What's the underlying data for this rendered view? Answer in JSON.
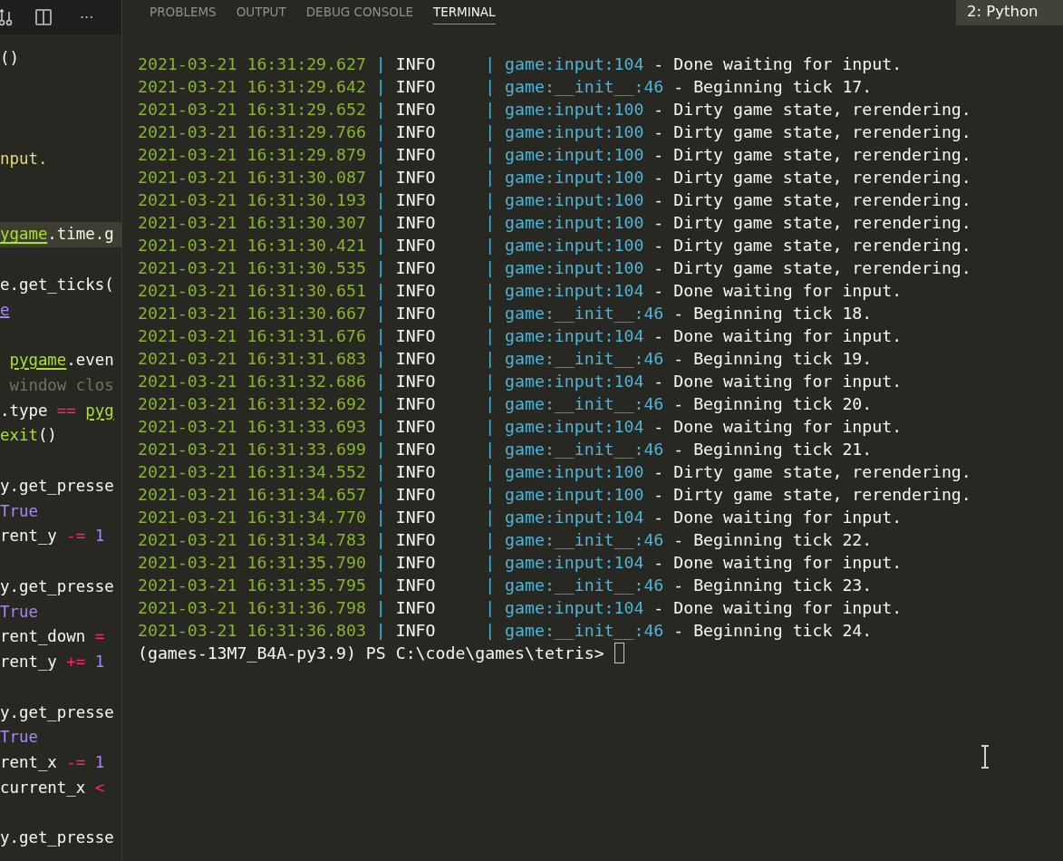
{
  "editor": {
    "toolbar": {
      "more": "···"
    },
    "lines": [
      {
        "kind": "code",
        "segments": [
          {
            "text": "()",
            "kind": "plain"
          }
        ]
      },
      {
        "kind": "blank"
      },
      {
        "kind": "blank"
      },
      {
        "kind": "blank"
      },
      {
        "kind": "code",
        "segments": [
          {
            "text": "nput.",
            "kind": "string"
          }
        ]
      },
      {
        "kind": "blank"
      },
      {
        "kind": "blank"
      },
      {
        "kind": "code",
        "current": true,
        "segments": [
          {
            "text": "ygame",
            "kind": "module"
          },
          {
            "text": ".time.g",
            "kind": "plain"
          }
        ]
      },
      {
        "kind": "blank"
      },
      {
        "kind": "code",
        "segments": [
          {
            "text": "e.get_ticks(",
            "kind": "plain"
          }
        ]
      },
      {
        "kind": "code",
        "segments": [
          {
            "text": "e",
            "kind": "constant-link"
          }
        ]
      },
      {
        "kind": "blank"
      },
      {
        "kind": "code",
        "indented": true,
        "segments": [
          {
            "text": "pygame",
            "kind": "module"
          },
          {
            "text": ".even",
            "kind": "plain"
          }
        ]
      },
      {
        "kind": "code",
        "indented": true,
        "segments": [
          {
            "text": "window clos",
            "kind": "comment"
          }
        ]
      },
      {
        "kind": "code",
        "segments": [
          {
            "text": ".type ",
            "kind": "plain"
          },
          {
            "text": "== ",
            "kind": "operator"
          },
          {
            "text": "pyg",
            "kind": "module"
          }
        ]
      },
      {
        "kind": "code",
        "segments": [
          {
            "text": "exit",
            "kind": "call"
          },
          {
            "text": "()",
            "kind": "plain"
          }
        ]
      },
      {
        "kind": "blank"
      },
      {
        "kind": "code",
        "segments": [
          {
            "text": "y.get_presse",
            "kind": "plain"
          }
        ]
      },
      {
        "kind": "code",
        "segments": [
          {
            "text": "True",
            "kind": "constant"
          }
        ]
      },
      {
        "kind": "code",
        "segments": [
          {
            "text": "rent_y ",
            "kind": "plain"
          },
          {
            "text": "-=",
            "kind": "operator"
          },
          {
            "text": " 1",
            "kind": "constant"
          }
        ]
      },
      {
        "kind": "blank"
      },
      {
        "kind": "code",
        "segments": [
          {
            "text": "y.get_presse",
            "kind": "plain"
          }
        ]
      },
      {
        "kind": "code",
        "segments": [
          {
            "text": "True",
            "kind": "constant"
          }
        ]
      },
      {
        "kind": "code",
        "segments": [
          {
            "text": "rent_down ",
            "kind": "plain"
          },
          {
            "text": "=",
            "kind": "operator"
          }
        ]
      },
      {
        "kind": "code",
        "segments": [
          {
            "text": "rent_y ",
            "kind": "plain"
          },
          {
            "text": "+=",
            "kind": "operator"
          },
          {
            "text": " 1",
            "kind": "constant"
          }
        ]
      },
      {
        "kind": "blank"
      },
      {
        "kind": "code",
        "segments": [
          {
            "text": "y.get_presse",
            "kind": "plain"
          }
        ]
      },
      {
        "kind": "code",
        "segments": [
          {
            "text": "True",
            "kind": "constant"
          }
        ]
      },
      {
        "kind": "code",
        "segments": [
          {
            "text": "rent_x ",
            "kind": "plain"
          },
          {
            "text": "-=",
            "kind": "operator"
          },
          {
            "text": " 1",
            "kind": "constant"
          }
        ]
      },
      {
        "kind": "code",
        "segments": [
          {
            "text": "current_x ",
            "kind": "plain"
          },
          {
            "text": "<",
            "kind": "operator"
          }
        ]
      },
      {
        "kind": "blank"
      },
      {
        "kind": "code",
        "segments": [
          {
            "text": "y.get_presse",
            "kind": "plain"
          }
        ]
      }
    ]
  },
  "panel": {
    "tabs": [
      {
        "label": "PROBLEMS",
        "selected": false
      },
      {
        "label": "OUTPUT",
        "selected": false
      },
      {
        "label": "DEBUG CONSOLE",
        "selected": false
      },
      {
        "label": "TERMINAL",
        "selected": true
      }
    ],
    "terminal_select": "2: Python",
    "log": [
      {
        "timestamp": "2021-03-21 16:31:29.627",
        "sep1": "|",
        "level": "INFO",
        "sep2": "|",
        "location": "game:input:104",
        "message": "- Done waiting for input."
      },
      {
        "timestamp": "2021-03-21 16:31:29.642",
        "sep1": "|",
        "level": "INFO",
        "sep2": "|",
        "location": "game:__init__:46",
        "message": "- Beginning tick 17."
      },
      {
        "timestamp": "2021-03-21 16:31:29.652",
        "sep1": "|",
        "level": "INFO",
        "sep2": "|",
        "location": "game:input:100",
        "message": "- Dirty game state, rerendering."
      },
      {
        "timestamp": "2021-03-21 16:31:29.766",
        "sep1": "|",
        "level": "INFO",
        "sep2": "|",
        "location": "game:input:100",
        "message": "- Dirty game state, rerendering."
      },
      {
        "timestamp": "2021-03-21 16:31:29.879",
        "sep1": "|",
        "level": "INFO",
        "sep2": "|",
        "location": "game:input:100",
        "message": "- Dirty game state, rerendering."
      },
      {
        "timestamp": "2021-03-21 16:31:30.087",
        "sep1": "|",
        "level": "INFO",
        "sep2": "|",
        "location": "game:input:100",
        "message": "- Dirty game state, rerendering."
      },
      {
        "timestamp": "2021-03-21 16:31:30.193",
        "sep1": "|",
        "level": "INFO",
        "sep2": "|",
        "location": "game:input:100",
        "message": "- Dirty game state, rerendering."
      },
      {
        "timestamp": "2021-03-21 16:31:30.307",
        "sep1": "|",
        "level": "INFO",
        "sep2": "|",
        "location": "game:input:100",
        "message": "- Dirty game state, rerendering."
      },
      {
        "timestamp": "2021-03-21 16:31:30.421",
        "sep1": "|",
        "level": "INFO",
        "sep2": "|",
        "location": "game:input:100",
        "message": "- Dirty game state, rerendering."
      },
      {
        "timestamp": "2021-03-21 16:31:30.535",
        "sep1": "|",
        "level": "INFO",
        "sep2": "|",
        "location": "game:input:100",
        "message": "- Dirty game state, rerendering."
      },
      {
        "timestamp": "2021-03-21 16:31:30.651",
        "sep1": "|",
        "level": "INFO",
        "sep2": "|",
        "location": "game:input:104",
        "message": "- Done waiting for input."
      },
      {
        "timestamp": "2021-03-21 16:31:30.667",
        "sep1": "|",
        "level": "INFO",
        "sep2": "|",
        "location": "game:__init__:46",
        "message": "- Beginning tick 18."
      },
      {
        "timestamp": "2021-03-21 16:31:31.676",
        "sep1": "|",
        "level": "INFO",
        "sep2": "|",
        "location": "game:input:104",
        "message": "- Done waiting for input."
      },
      {
        "timestamp": "2021-03-21 16:31:31.683",
        "sep1": "|",
        "level": "INFO",
        "sep2": "|",
        "location": "game:__init__:46",
        "message": "- Beginning tick 19."
      },
      {
        "timestamp": "2021-03-21 16:31:32.686",
        "sep1": "|",
        "level": "INFO",
        "sep2": "|",
        "location": "game:input:104",
        "message": "- Done waiting for input."
      },
      {
        "timestamp": "2021-03-21 16:31:32.692",
        "sep1": "|",
        "level": "INFO",
        "sep2": "|",
        "location": "game:__init__:46",
        "message": "- Beginning tick 20."
      },
      {
        "timestamp": "2021-03-21 16:31:33.693",
        "sep1": "|",
        "level": "INFO",
        "sep2": "|",
        "location": "game:input:104",
        "message": "- Done waiting for input."
      },
      {
        "timestamp": "2021-03-21 16:31:33.699",
        "sep1": "|",
        "level": "INFO",
        "sep2": "|",
        "location": "game:__init__:46",
        "message": "- Beginning tick 21."
      },
      {
        "timestamp": "2021-03-21 16:31:34.552",
        "sep1": "|",
        "level": "INFO",
        "sep2": "|",
        "location": "game:input:100",
        "message": "- Dirty game state, rerendering."
      },
      {
        "timestamp": "2021-03-21 16:31:34.657",
        "sep1": "|",
        "level": "INFO",
        "sep2": "|",
        "location": "game:input:100",
        "message": "- Dirty game state, rerendering."
      },
      {
        "timestamp": "2021-03-21 16:31:34.770",
        "sep1": "|",
        "level": "INFO",
        "sep2": "|",
        "location": "game:input:104",
        "message": "- Done waiting for input."
      },
      {
        "timestamp": "2021-03-21 16:31:34.783",
        "sep1": "|",
        "level": "INFO",
        "sep2": "|",
        "location": "game:__init__:46",
        "message": "- Beginning tick 22."
      },
      {
        "timestamp": "2021-03-21 16:31:35.790",
        "sep1": "|",
        "level": "INFO",
        "sep2": "|",
        "location": "game:input:104",
        "message": "- Done waiting for input."
      },
      {
        "timestamp": "2021-03-21 16:31:35.795",
        "sep1": "|",
        "level": "INFO",
        "sep2": "|",
        "location": "game:__init__:46",
        "message": "- Beginning tick 23."
      },
      {
        "timestamp": "2021-03-21 16:31:36.798",
        "sep1": "|",
        "level": "INFO",
        "sep2": "|",
        "location": "game:input:104",
        "message": "- Done waiting for input."
      },
      {
        "timestamp": "2021-03-21 16:31:36.803",
        "sep1": "|",
        "level": "INFO",
        "sep2": "|",
        "location": "game:__init__:46",
        "message": "- Beginning tick 24."
      }
    ],
    "prompt": "(games-13M7_B4A-py3.9) PS C:\\code\\games\\tetris>"
  }
}
